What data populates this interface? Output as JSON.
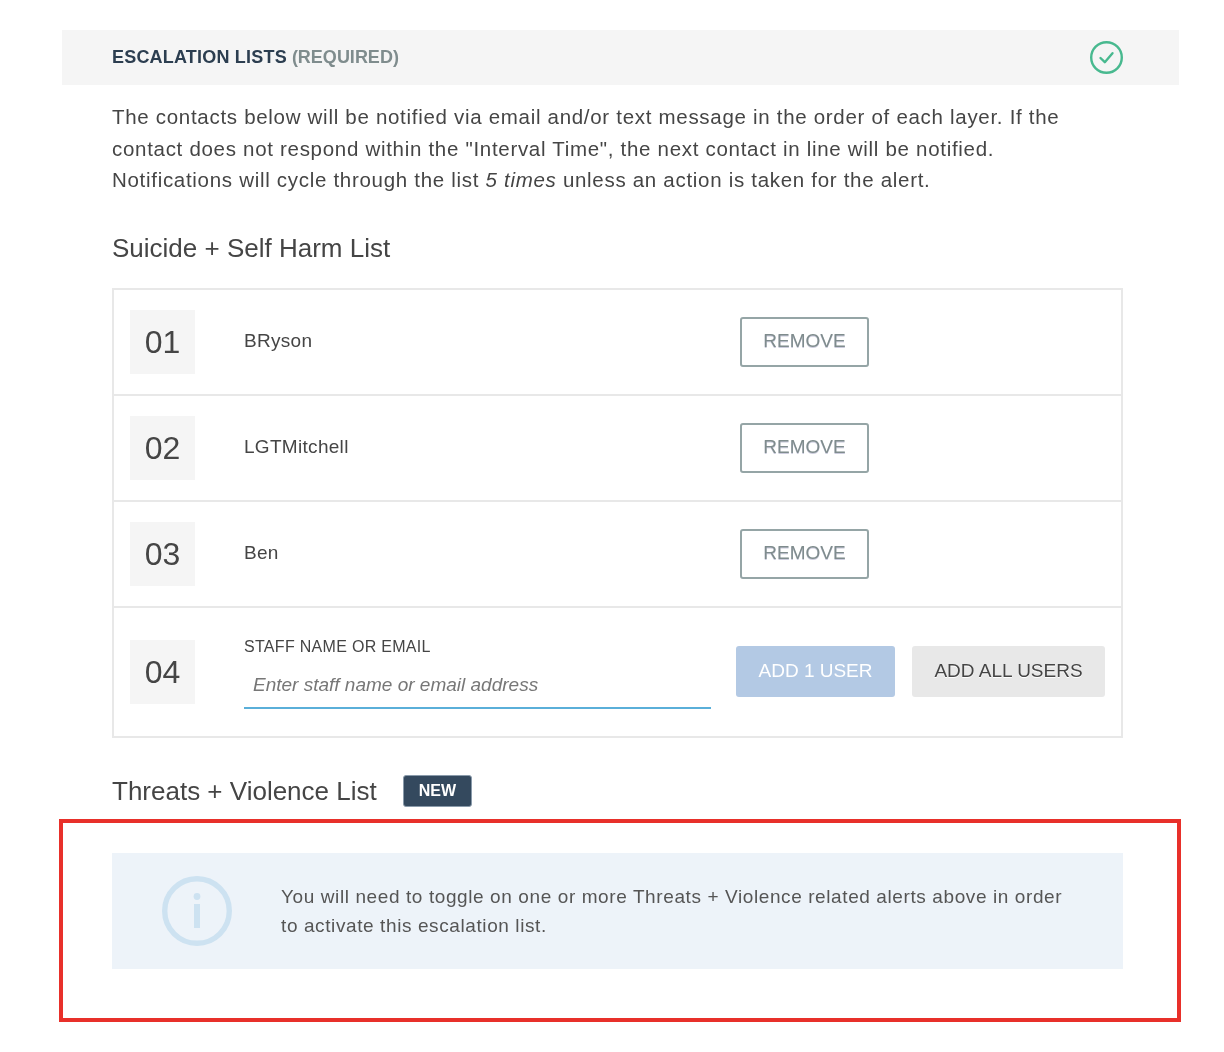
{
  "section": {
    "title": "ESCALATION LISTS",
    "qualifier": "(REQUIRED)",
    "complete": true
  },
  "intro": "The contacts below will be notified via email and/or text message in the order of each layer. If the contact does not respond within the \"Interval Time\", the next contact in line will be notified. Notifications will cycle through the list *5 times* unless an action is taken for the alert.",
  "lists": [
    {
      "kind": "entries",
      "title": "Suicide + Self Harm List",
      "entries": [
        {
          "number": "01",
          "name": "BRyson",
          "action": "REMOVE"
        },
        {
          "number": "02",
          "name": "LGTMitchell",
          "action": "REMOVE"
        },
        {
          "number": "03",
          "name": "Ben",
          "action": "REMOVE"
        }
      ],
      "new_entry": {
        "number": "04",
        "label": "STAFF NAME OR EMAIL",
        "placeholder": "Enter staff name or email address",
        "buttons": [
          {
            "kind": "primary",
            "label": "ADD 1 USER",
            "disabled": true
          },
          {
            "kind": "secondary",
            "label": "ADD ALL USERS",
            "disabled": false
          }
        ]
      }
    },
    {
      "kind": "notice",
      "title": "Threats + Violence List",
      "badge": "NEW",
      "notice": {
        "text": "You will need to toggle on one or more Threats + Violence related alerts above in order to activate this escalation list.",
        "highlighted": true
      }
    }
  ]
}
